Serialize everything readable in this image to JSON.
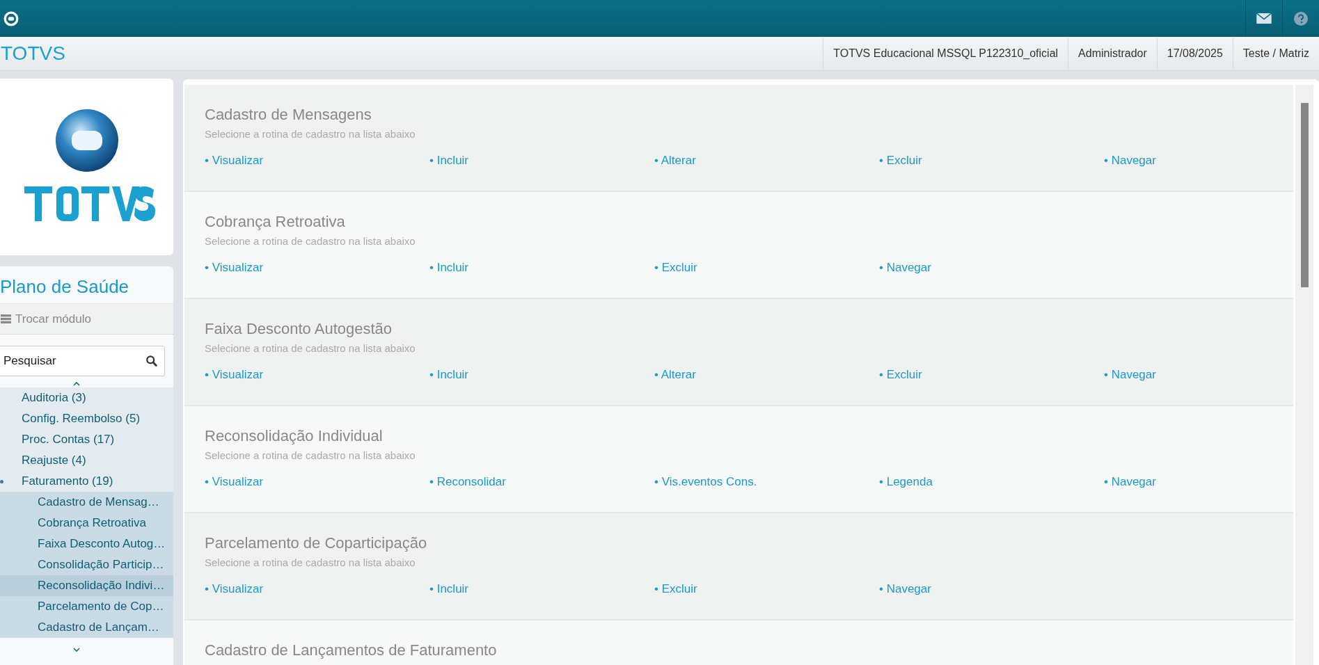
{
  "header": {
    "brand": "TOTVS",
    "info": [
      "TOTVS Educacional MSSQL P122310_oficial",
      "Administrador",
      "17/08/2025",
      "Teste / Matriz"
    ]
  },
  "sidebar": {
    "module_title": "Plano de Saúde",
    "switch_module": "Trocar módulo",
    "search": {
      "placeholder": "Pesquisar"
    },
    "items": [
      {
        "label": "Auditoria (3)",
        "expanded": false
      },
      {
        "label": "Config. Reembolso (5)",
        "expanded": false
      },
      {
        "label": "Proc. Contas (17)",
        "expanded": false
      },
      {
        "label": "Reajuste (4)",
        "expanded": false
      },
      {
        "label": "Faturamento (19)",
        "expanded": true,
        "children": [
          {
            "label": "Cadastro de Mensag…",
            "selected": false
          },
          {
            "label": "Cobrança Retroativa",
            "selected": false
          },
          {
            "label": "Faixa Desconto Autog…",
            "selected": false
          },
          {
            "label": "Consolidação Particip…",
            "selected": false
          },
          {
            "label": "Reconsolidação Indivi…",
            "selected": true
          },
          {
            "label": "Parcelamento de Cop…",
            "selected": false
          },
          {
            "label": "Cadastro de Lançam…",
            "selected": false
          }
        ]
      }
    ]
  },
  "routines": [
    {
      "title": "Cadastro de Mensagens",
      "subtitle": "Selecione a rotina de cadastro na lista abaixo",
      "actions": [
        "• Visualizar",
        "• Incluir",
        "• Alterar",
        "• Excluir",
        "• Navegar"
      ]
    },
    {
      "title": "Cobrança Retroativa",
      "subtitle": "Selecione a rotina de cadastro na lista abaixo",
      "actions": [
        "• Visualizar",
        "• Incluir",
        "• Excluir",
        "• Navegar"
      ]
    },
    {
      "title": "Faixa Desconto Autogestão",
      "subtitle": "Selecione a rotina de cadastro na lista abaixo",
      "actions": [
        "• Visualizar",
        "• Incluir",
        "• Alterar",
        "• Excluir",
        "• Navegar"
      ]
    },
    {
      "title": "Reconsolidação Individual",
      "subtitle": "Selecione a rotina de cadastro na lista abaixo",
      "actions": [
        "• Visualizar",
        "• Reconsolidar",
        "• Vis.eventos Cons.",
        "• Legenda",
        "• Navegar"
      ]
    },
    {
      "title": "Parcelamento de Coparticipação",
      "subtitle": "Selecione a rotina de cadastro na lista abaixo",
      "actions": [
        "• Visualizar",
        "• Incluir",
        "• Excluir",
        "• Navegar"
      ]
    },
    {
      "title": "Cadastro de Lançamentos de Faturamento"
    }
  ]
}
